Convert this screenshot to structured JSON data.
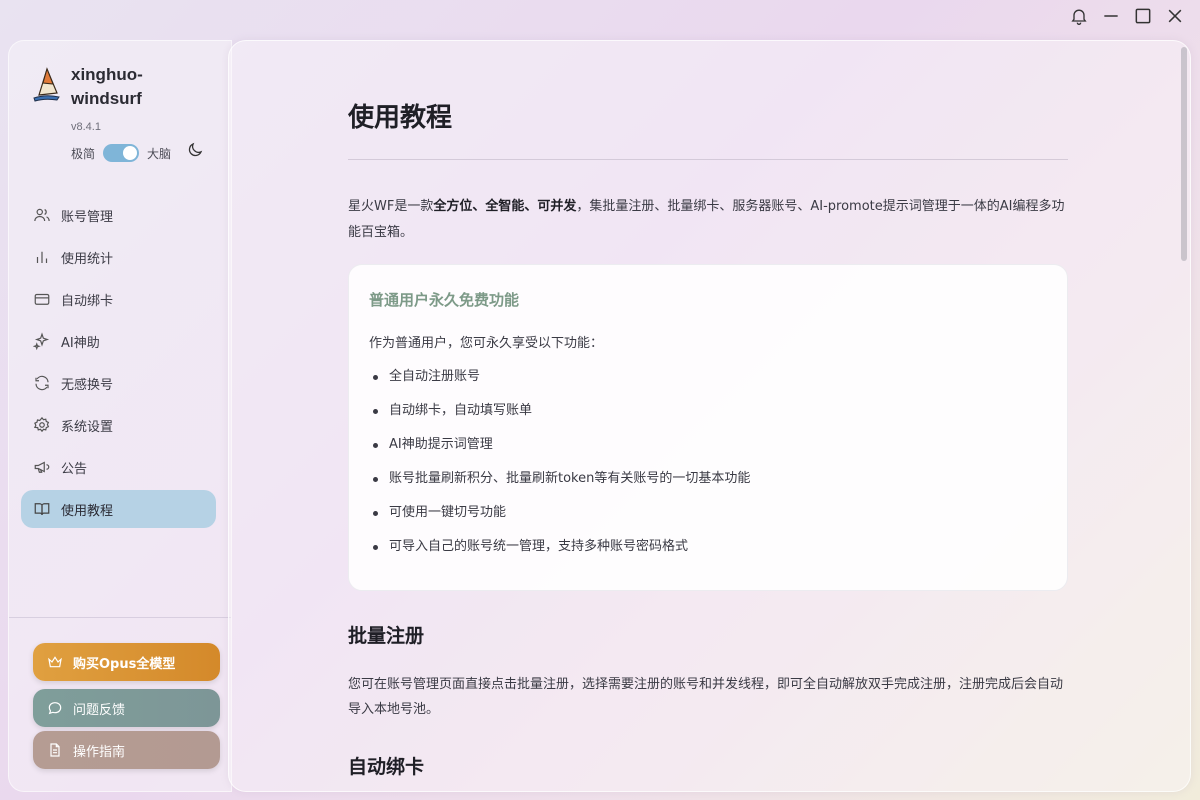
{
  "app": {
    "name": "xinghuo-windsurf",
    "version": "v8.4.1",
    "mode_left": "极简",
    "mode_right": "大脑",
    "mode_toggle_on": true
  },
  "sidebar": {
    "items": [
      {
        "label": "账号管理",
        "icon": "users-icon"
      },
      {
        "label": "使用统计",
        "icon": "bar-chart-icon"
      },
      {
        "label": "自动绑卡",
        "icon": "credit-card-icon"
      },
      {
        "label": "AI神助",
        "icon": "sparkles-icon"
      },
      {
        "label": "无感换号",
        "icon": "refresh-icon"
      },
      {
        "label": "系统设置",
        "icon": "gear-icon"
      },
      {
        "label": "公告",
        "icon": "megaphone-icon"
      },
      {
        "label": "使用教程",
        "icon": "book-icon",
        "active": true
      }
    ],
    "buttons": {
      "opus": "购买Opus全模型",
      "feedback": "问题反馈",
      "guide": "操作指南"
    }
  },
  "colors": {
    "accent": "#b6d2e5",
    "opus_button": "#d99434",
    "feedback_button": "#7f9b98",
    "guide_button": "#b59c93",
    "card_title": "#7d9a88"
  },
  "main": {
    "title": "使用教程",
    "intro": {
      "prefix": "星火WF是一款",
      "bold": "全方位、全智能、可并发",
      "suffix": "，集批量注册、批量绑卡、服务器账号、AI-promote提示词管理于一体的AI编程多功能百宝箱。"
    },
    "card": {
      "title": "普通用户永久免费功能",
      "subtitle": "作为普通用户，您可永久享受以下功能：",
      "features": [
        "全自动注册账号",
        "自动绑卡，自动填写账单",
        "AI神助提示词管理",
        "账号批量刷新积分、批量刷新token等有关账号的一切基本功能",
        "可使用一键切号功能",
        "可导入自己的账号统一管理，支持多种账号密码格式"
      ]
    },
    "sections": [
      {
        "heading": "批量注册",
        "body": "您可在账号管理页面直接点击批量注册，选择需要注册的账号和并发线程，即可全自动解放双手完成注册，注册完成后会自动导入本地号池。"
      },
      {
        "heading": "自动绑卡",
        "body": ""
      }
    ]
  }
}
